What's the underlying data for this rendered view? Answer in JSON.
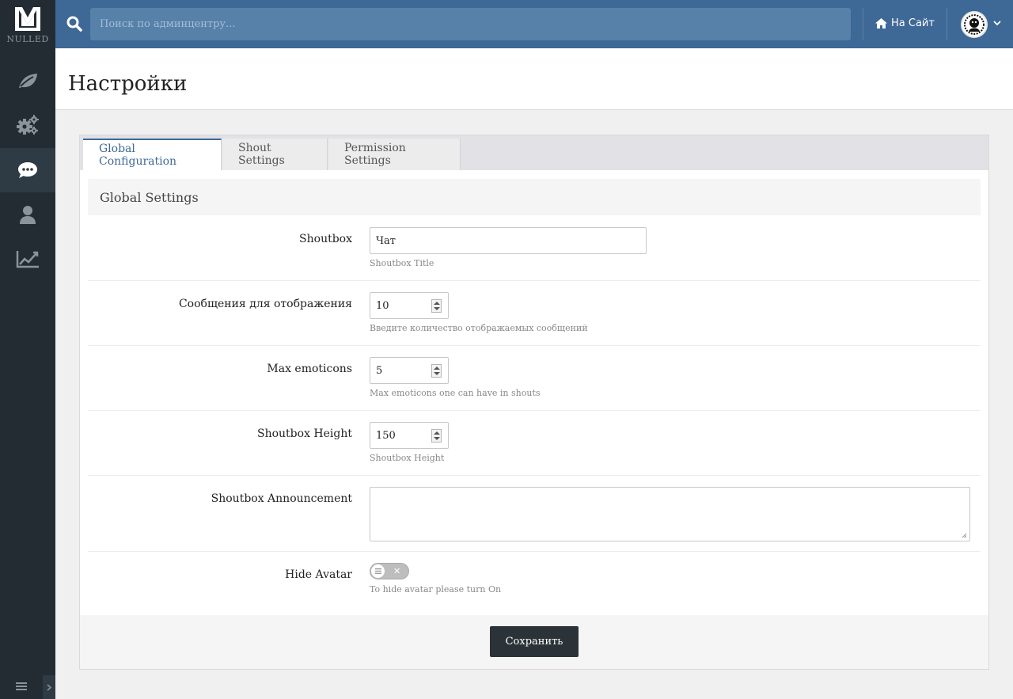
{
  "sidebar": {
    "logo_text": "NULLED",
    "items": [
      {
        "name": "leaf-icon"
      },
      {
        "name": "gears-icon"
      },
      {
        "name": "comments-icon",
        "active": true
      },
      {
        "name": "user-icon"
      },
      {
        "name": "chart-line-icon"
      }
    ]
  },
  "topbar": {
    "search_placeholder": "Поиск по админцентру...",
    "site_link": "На Сайт"
  },
  "page": {
    "title": "Настройки"
  },
  "tabs": [
    {
      "label": "Global Configuration",
      "active": true
    },
    {
      "label": "Shout Settings"
    },
    {
      "label": "Permission Settings"
    }
  ],
  "section_title": "Global Settings",
  "fields": {
    "shoutbox": {
      "label": "Shoutbox",
      "value": "Чат",
      "help": "Shoutbox Title"
    },
    "messages": {
      "label": "Сообщения для отображения",
      "value": "10",
      "help": "Введите количество отображаемых сообщений"
    },
    "max_emoticons": {
      "label": "Max emoticons",
      "value": "5",
      "help": "Max emoticons one can have in shouts"
    },
    "height": {
      "label": "Shoutbox Height",
      "value": "150",
      "help": "Shoutbox Height"
    },
    "announcement": {
      "label": "Shoutbox Announcement",
      "value": ""
    },
    "hide_avatar": {
      "label": "Hide Avatar",
      "enabled": false,
      "help": "To hide avatar please turn On"
    }
  },
  "footer": {
    "save_label": "Сохранить"
  },
  "colors": {
    "topbar": "#3e6896",
    "sidebar": "#232c33",
    "accent": "#3e6896",
    "button": "#2b3338"
  }
}
